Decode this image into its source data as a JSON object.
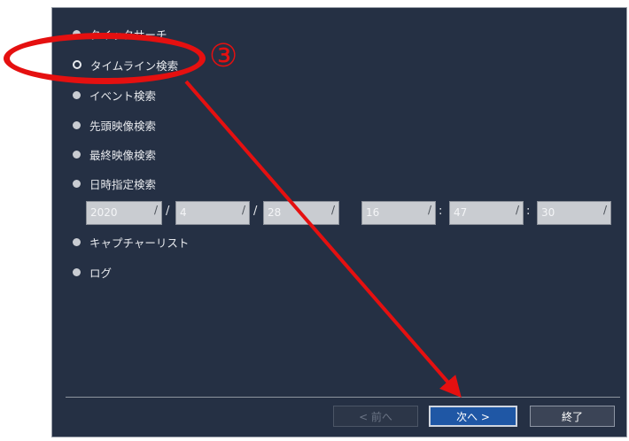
{
  "options": [
    {
      "label": "クイックサーチ"
    },
    {
      "label": "タイムライン検索"
    },
    {
      "label": "イベント検索"
    },
    {
      "label": "先頭映像検索"
    },
    {
      "label": "最終映像検索"
    },
    {
      "label": "日時指定検索"
    },
    {
      "label": "キャプチャーリスト"
    },
    {
      "label": "ログ"
    }
  ],
  "datetime": {
    "year": "2020",
    "month": "4",
    "day": "28",
    "hour": "16",
    "minute": "47",
    "second": "30",
    "date_separator": "/",
    "time_separator": ":",
    "field_mark": "/"
  },
  "buttons": {
    "prev": "< 前へ",
    "next": "次へ >",
    "end": "終了"
  },
  "annotation": {
    "step": "③",
    "color": "#e51010"
  },
  "colors": {
    "panel": "#253044",
    "next_button": "#1f57a5"
  }
}
